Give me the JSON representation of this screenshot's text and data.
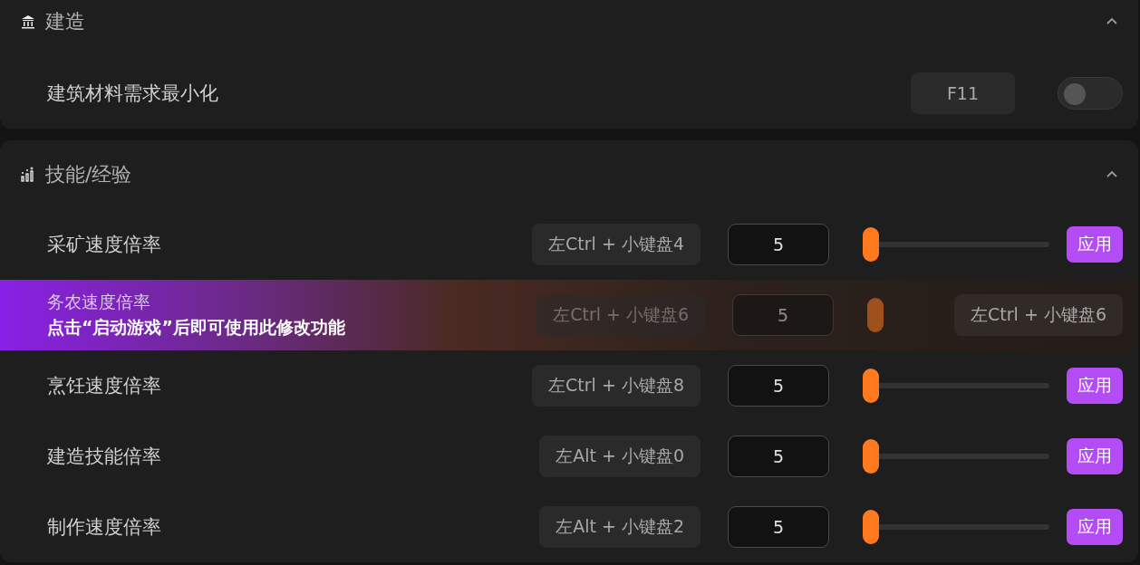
{
  "sections": [
    {
      "title": "建造",
      "expanded": true,
      "rows": [
        {
          "kind": "toggle",
          "name": "建筑材料需求最小化",
          "hotkey": "F11",
          "on": false
        }
      ]
    },
    {
      "title": "技能/经验",
      "expanded": true,
      "rows": [
        {
          "kind": "slider",
          "name": "采矿速度倍率",
          "hotkey": "左Ctrl + 小键盘4",
          "value": "5",
          "level": 0,
          "button": "应用"
        },
        {
          "kind": "locked",
          "name": "务农速度倍率",
          "message": "点击“启动游戏”后即可使用此修改功能",
          "hotkey": "左Ctrl + 小键盘6",
          "value": "5",
          "overlay_hotkey": "左Ctrl + 小键盘6"
        },
        {
          "kind": "slider",
          "name": "烹饪速度倍率",
          "hotkey": "左Ctrl + 小键盘8",
          "value": "5",
          "level": 0,
          "button": "应用"
        },
        {
          "kind": "slider",
          "name": "建造技能倍率",
          "hotkey": "左Alt + 小键盘0",
          "value": "5",
          "level": 0,
          "button": "应用"
        },
        {
          "kind": "slider",
          "name": "制作速度倍率",
          "hotkey": "左Alt + 小键盘2",
          "value": "5",
          "level": 0,
          "button": "应用"
        }
      ]
    }
  ]
}
